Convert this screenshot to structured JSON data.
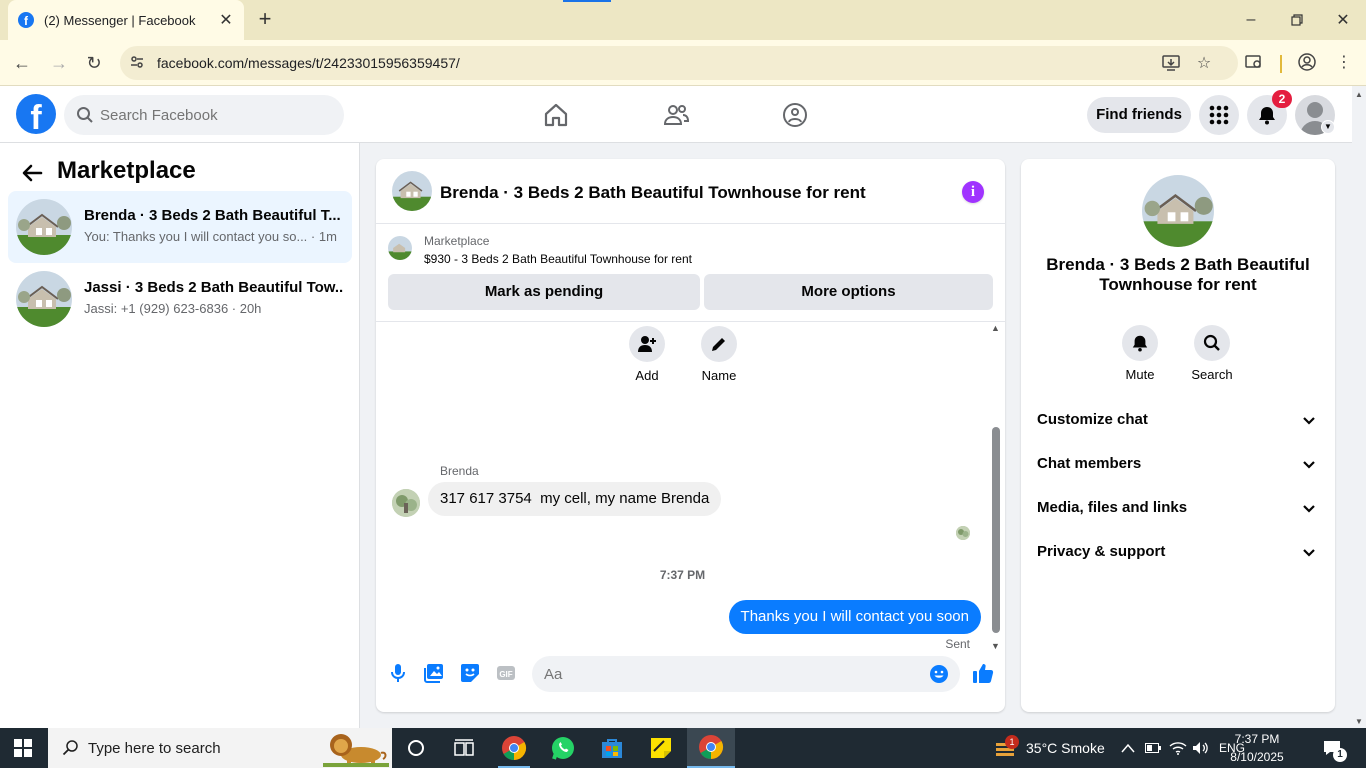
{
  "browser": {
    "tab_title": "(2) Messenger | Facebook",
    "url": "facebook.com/messages/t/24233015956359457/"
  },
  "fb_header": {
    "search_placeholder": "Search Facebook",
    "find_friends_label": "Find friends",
    "notification_count": "2",
    "brand_color": "#1877f2"
  },
  "sidebar": {
    "title": "Marketplace",
    "conversations": [
      {
        "name": "Brenda · 3 Beds 2 Bath Beautiful T...",
        "preview": "You: Thanks you I will contact you so... · 1m",
        "active": true
      },
      {
        "name": "Jassi · 3 Beds 2 Bath Beautiful Tow...",
        "preview": "Jassi: +1 (929) 623-6836 · 20h",
        "active": false
      }
    ]
  },
  "chat": {
    "title": "Brenda · 3 Beds 2 Bath Beautiful Townhouse for rent",
    "marketplace_label": "Marketplace",
    "listing": "$930 - 3 Beds 2 Bath Beautiful Townhouse for rent",
    "mark_pending_label": "Mark as pending",
    "more_options_label": "More options",
    "actions": {
      "add_label": "Add",
      "name_label": "Name"
    },
    "messages": {
      "sender_name": "Brenda",
      "incoming_text": "317 617 3754  my cell, my name Brenda",
      "timestamp": "7:37 PM",
      "outgoing_text": "Thanks you I will contact you soon",
      "status": "Sent"
    },
    "composer_placeholder": "Aa",
    "accent_color": "#0a7cff"
  },
  "info_panel": {
    "name": "Brenda · 3 Beds 2 Bath Beautiful Townhouse for rent",
    "mute_label": "Mute",
    "search_label": "Search",
    "sections": [
      "Customize chat",
      "Chat members",
      "Media, files and links",
      "Privacy & support"
    ]
  },
  "taskbar": {
    "search_text": "Type here to search",
    "weather": "35°C  Smoke",
    "weather_badge": "1",
    "language": "ENG",
    "time": "7:37 PM",
    "date": "8/10/2025",
    "notification_count": "1"
  }
}
